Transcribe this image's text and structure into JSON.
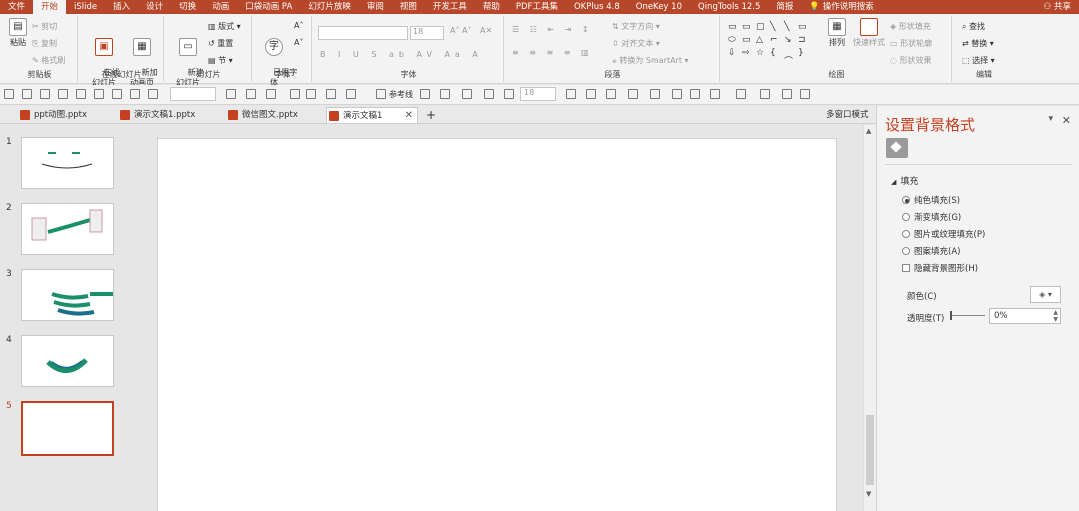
{
  "menubar": {
    "tabs": [
      "文件",
      "开始",
      "iSlide",
      "插入",
      "设计",
      "切换",
      "动画",
      "口袋动画 PA",
      "幻灯片放映",
      "审阅",
      "视图",
      "开发工具",
      "帮助",
      "PDF工具集",
      "OKPlus 4.8",
      "OneKey 10",
      "QingTools 12.5",
      "简报"
    ],
    "active_tab": "开始",
    "search": "操作说明搜索",
    "share": "共享"
  },
  "ribbon": {
    "clipboard": {
      "paste": "粘贴",
      "cut": "剪切",
      "copy": "复制",
      "format_painter": "格式刷",
      "label": "剪贴板"
    },
    "online": {
      "online_slide": "在线\n幻灯片",
      "new_page": "新加\n动画页",
      "label": "在线幻灯片"
    },
    "slides": {
      "new_slide": "新建\n幻灯片",
      "layout": "版式",
      "reset": "重置",
      "section": "节",
      "label": "幻灯片"
    },
    "font_group": {
      "common_font": "已用字\n体",
      "label": "字体"
    },
    "font": {
      "size": "18",
      "label": "字体"
    },
    "paragraph": {
      "text_direction": "文字方向",
      "align_text": "对齐文本",
      "smartart": "转换为 SmartArt",
      "label": "段落"
    },
    "drawing": {
      "arrange": "排列",
      "quick_styles": "快速样式",
      "shape_fill": "形状填充",
      "shape_outline": "形状轮廓",
      "shape_effects": "形状效果",
      "label": "绘图"
    },
    "editing": {
      "find": "查找",
      "replace": "替换",
      "select": "选择",
      "label": "编辑"
    }
  },
  "quickbar": {
    "guides": "参考线",
    "size": "18"
  },
  "doctabs": {
    "tabs": [
      "ppt动图.pptx",
      "演示文稿1.pptx",
      "微信图文.pptx",
      "演示文稿1"
    ],
    "active": "演示文稿1",
    "multi_window": "多窗口模式"
  },
  "thumbnails": {
    "numbers": [
      "1",
      "2",
      "3",
      "4",
      "5"
    ],
    "active": "5"
  },
  "pane": {
    "title": "设置背景格式",
    "section": "填充",
    "options": [
      "纯色填充(S)",
      "渐变填充(G)",
      "图片或纹理填充(P)",
      "图案填充(A)"
    ],
    "selected_option": "纯色填充(S)",
    "hide_bg": "隐藏背景图形(H)",
    "color_label": "颜色(C)",
    "transparency_label": "透明度(T)",
    "transparency_value": "0%"
  },
  "colors": {
    "accent": "#b7472a",
    "ribbon_bg": "#f3f3f3",
    "workspace": "#e6e6e6",
    "active_thumb": "#c4411f"
  }
}
